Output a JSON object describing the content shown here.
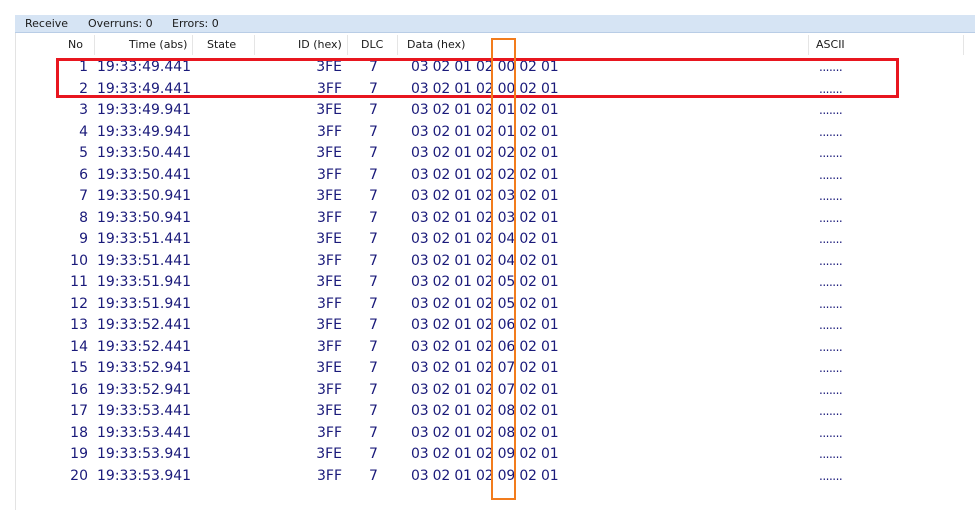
{
  "status": {
    "receive": "Receive",
    "overruns": "Overruns: 0",
    "errors": "Errors: 0"
  },
  "columns": {
    "no": "No",
    "time": "Time (abs)",
    "state": "State",
    "id": "ID (hex)",
    "dlc": "DLC",
    "data": "Data (hex)",
    "ascii": "ASCII"
  },
  "rows": [
    {
      "no": "1",
      "time": "19:33:49.441",
      "state": "",
      "id": "3FE",
      "dlc": "7",
      "data": "03 02 01 02 00 02 01",
      "ascii": "......."
    },
    {
      "no": "2",
      "time": "19:33:49.441",
      "state": "",
      "id": "3FF",
      "dlc": "7",
      "data": "03 02 01 02 00 02 01",
      "ascii": "......."
    },
    {
      "no": "3",
      "time": "19:33:49.941",
      "state": "",
      "id": "3FE",
      "dlc": "7",
      "data": "03 02 01 02 01 02 01",
      "ascii": "......."
    },
    {
      "no": "4",
      "time": "19:33:49.941",
      "state": "",
      "id": "3FF",
      "dlc": "7",
      "data": "03 02 01 02 01 02 01",
      "ascii": "......."
    },
    {
      "no": "5",
      "time": "19:33:50.441",
      "state": "",
      "id": "3FE",
      "dlc": "7",
      "data": "03 02 01 02 02 02 01",
      "ascii": "......."
    },
    {
      "no": "6",
      "time": "19:33:50.441",
      "state": "",
      "id": "3FF",
      "dlc": "7",
      "data": "03 02 01 02 02 02 01",
      "ascii": "......."
    },
    {
      "no": "7",
      "time": "19:33:50.941",
      "state": "",
      "id": "3FE",
      "dlc": "7",
      "data": "03 02 01 02 03 02 01",
      "ascii": "......."
    },
    {
      "no": "8",
      "time": "19:33:50.941",
      "state": "",
      "id": "3FF",
      "dlc": "7",
      "data": "03 02 01 02 03 02 01",
      "ascii": "......."
    },
    {
      "no": "9",
      "time": "19:33:51.441",
      "state": "",
      "id": "3FE",
      "dlc": "7",
      "data": "03 02 01 02 04 02 01",
      "ascii": "......."
    },
    {
      "no": "10",
      "time": "19:33:51.441",
      "state": "",
      "id": "3FF",
      "dlc": "7",
      "data": "03 02 01 02 04 02 01",
      "ascii": "......."
    },
    {
      "no": "11",
      "time": "19:33:51.941",
      "state": "",
      "id": "3FE",
      "dlc": "7",
      "data": "03 02 01 02 05 02 01",
      "ascii": "......."
    },
    {
      "no": "12",
      "time": "19:33:51.941",
      "state": "",
      "id": "3FF",
      "dlc": "7",
      "data": "03 02 01 02 05 02 01",
      "ascii": "......."
    },
    {
      "no": "13",
      "time": "19:33:52.441",
      "state": "",
      "id": "3FE",
      "dlc": "7",
      "data": "03 02 01 02 06 02 01",
      "ascii": "......."
    },
    {
      "no": "14",
      "time": "19:33:52.441",
      "state": "",
      "id": "3FF",
      "dlc": "7",
      "data": "03 02 01 02 06 02 01",
      "ascii": "......."
    },
    {
      "no": "15",
      "time": "19:33:52.941",
      "state": "",
      "id": "3FE",
      "dlc": "7",
      "data": "03 02 01 02 07 02 01",
      "ascii": "......."
    },
    {
      "no": "16",
      "time": "19:33:52.941",
      "state": "",
      "id": "3FF",
      "dlc": "7",
      "data": "03 02 01 02 07 02 01",
      "ascii": "......."
    },
    {
      "no": "17",
      "time": "19:33:53.441",
      "state": "",
      "id": "3FE",
      "dlc": "7",
      "data": "03 02 01 02 08 02 01",
      "ascii": "......."
    },
    {
      "no": "18",
      "time": "19:33:53.441",
      "state": "",
      "id": "3FF",
      "dlc": "7",
      "data": "03 02 01 02 08 02 01",
      "ascii": "......."
    },
    {
      "no": "19",
      "time": "19:33:53.941",
      "state": "",
      "id": "3FE",
      "dlc": "7",
      "data": "03 02 01 02 09 02 01",
      "ascii": "......."
    },
    {
      "no": "20",
      "time": "19:33:53.941",
      "state": "",
      "id": "3FF",
      "dlc": "7",
      "data": "03 02 01 02 09 02 01",
      "ascii": "......."
    }
  ],
  "annotations": {
    "red_box_color": "#e8161f",
    "orange_box_color": "#f27c1d"
  }
}
